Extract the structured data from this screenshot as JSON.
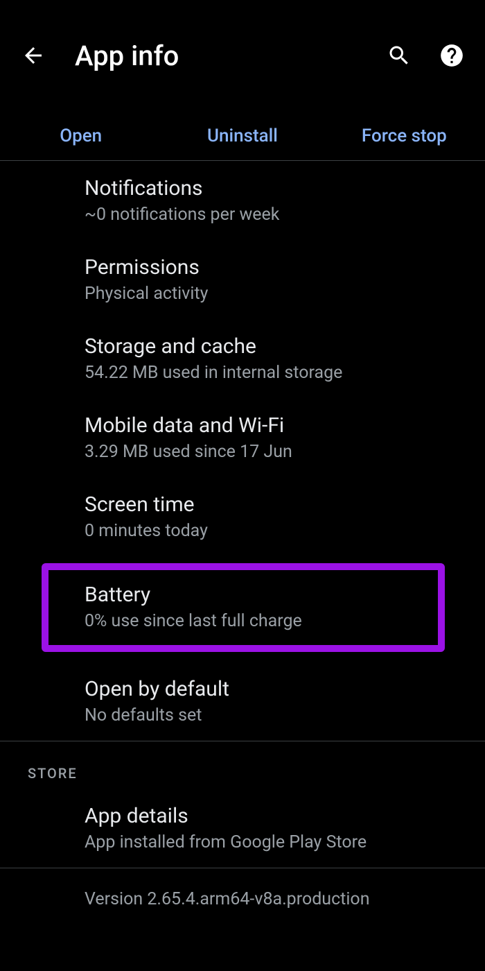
{
  "header": {
    "title": "App info"
  },
  "actions": {
    "open": "Open",
    "uninstall": "Uninstall",
    "forcestop": "Force stop"
  },
  "items": {
    "notifications": {
      "title": "Notifications",
      "sub": "~0 notifications per week"
    },
    "permissions": {
      "title": "Permissions",
      "sub": "Physical activity"
    },
    "storage": {
      "title": "Storage and cache",
      "sub": "54.22 MB used in internal storage"
    },
    "mobiledata": {
      "title": "Mobile data and Wi-Fi",
      "sub": "3.29 MB used since 17 Jun"
    },
    "screentime": {
      "title": "Screen time",
      "sub": "0 minutes today"
    },
    "battery": {
      "title": "Battery",
      "sub": "0% use since last full charge"
    },
    "openbydefault": {
      "title": "Open by default",
      "sub": "No defaults set"
    },
    "appdetails": {
      "title": "App details",
      "sub": "App installed from Google Play Store"
    }
  },
  "section": {
    "store": "STORE"
  },
  "version": "Version 2.65.4.arm64-v8a.production"
}
